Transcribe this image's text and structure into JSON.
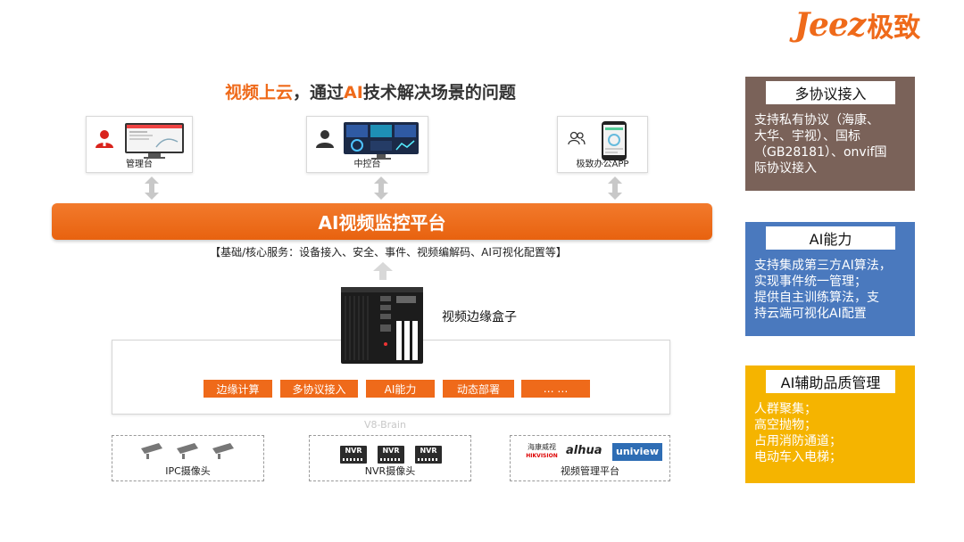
{
  "logo": {
    "latin": "Jeez",
    "cn": "极致"
  },
  "headline": {
    "highlight1": "视频上云",
    "mid1": "，通过",
    "highlight2": "AI",
    "mid2": "技术解决场景的问题"
  },
  "clients": [
    {
      "label": "管理台",
      "icon": "user-red-icon"
    },
    {
      "label": "中控台",
      "icon": "user-dark-icon"
    },
    {
      "label": "极致办公APP",
      "icon": "users-outline-icon"
    }
  ],
  "platform": {
    "title": "AI视频监控平台",
    "core_services": "【基础/核心服务：设备接入、安全、事件、视频编解码、AI可视化配置等】"
  },
  "edge": {
    "box_label": "视频边缘盒子",
    "watermark": "V8-Brain",
    "capabilities": [
      "边缘计算",
      "多协议接入",
      "AI能力",
      "动态部署",
      "… …"
    ]
  },
  "sources": [
    {
      "label": "IPC摄像头"
    },
    {
      "label": "NVR摄像头",
      "device_labels": [
        "NVR",
        "NVR",
        "NVR"
      ]
    },
    {
      "label": "视频管理平台",
      "brands": [
        "海康威视",
        "HIKVISION",
        "alhua",
        "uniview"
      ]
    }
  ],
  "panels": {
    "protocol": {
      "title": "多协议接入",
      "lines": [
        "支持私有协议（海康、",
        "大华、宇视）、国标",
        "（GB28181）、onvif国",
        "际协议接入"
      ]
    },
    "ai": {
      "title": "AI能力",
      "lines": [
        "支持集成第三方AI算法，",
        "实现事件统一管理；",
        "提供自主训练算法，支",
        "持云端可视化AI配置"
      ]
    },
    "quality": {
      "title": "AI辅助品质管理",
      "lines": [
        "人群聚集；",
        "高空抛物；",
        "占用消防通道；",
        "电动车入电梯；"
      ]
    }
  },
  "colors": {
    "accent": "#ef6a1a",
    "protocol_panel": "#7a6259",
    "ai_panel": "#4a79be",
    "quality_panel": "#f5b400"
  }
}
